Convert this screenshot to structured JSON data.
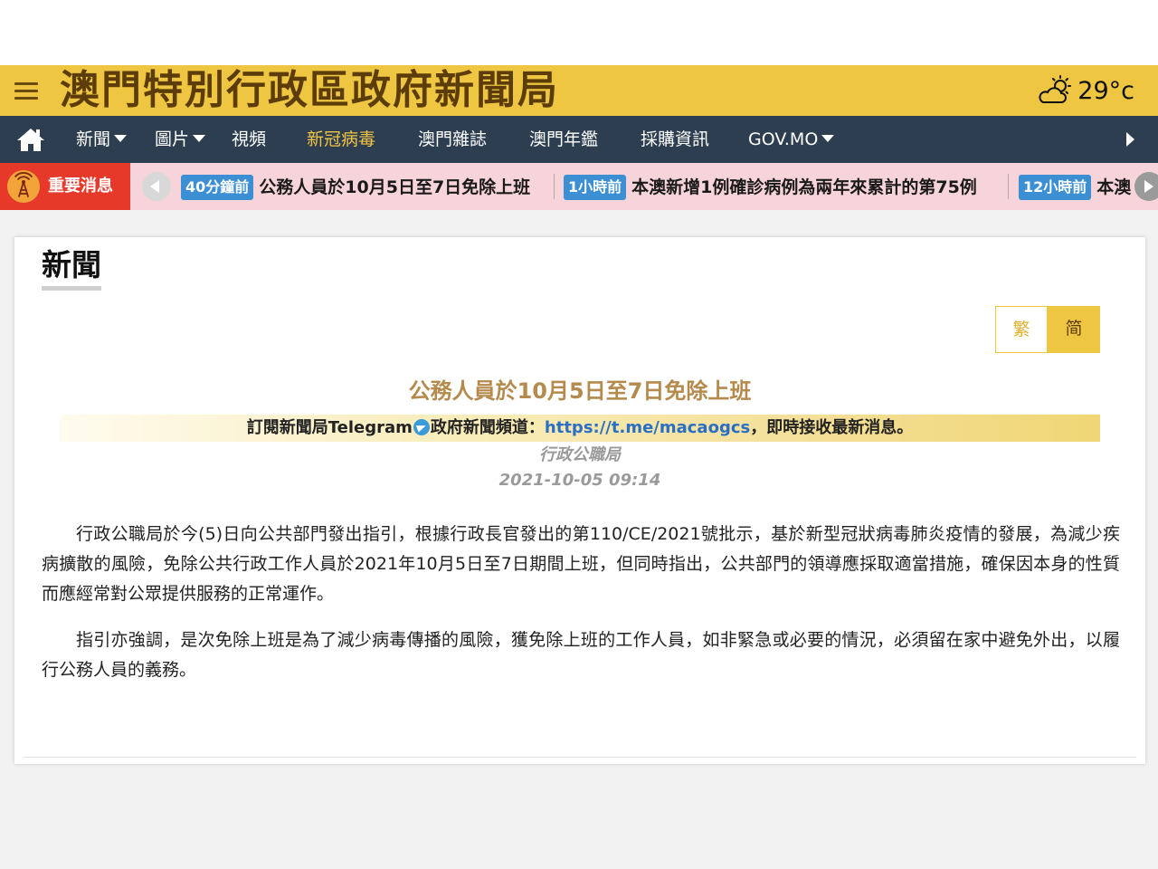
{
  "header": {
    "title": "澳門特別行政區政府新聞局",
    "temperature": "29°c",
    "weather_icon": "partly-cloudy-icon"
  },
  "nav": {
    "items": [
      {
        "label": "新聞"
      },
      {
        "label": "圖片"
      },
      {
        "label": "視頻"
      },
      {
        "label": "新冠病毒"
      },
      {
        "label": "澳門雜誌"
      },
      {
        "label": "澳門年鑑"
      },
      {
        "label": "採購資訊"
      },
      {
        "label": "GOV.MO"
      }
    ],
    "active_color": "#f2c445"
  },
  "ticker": {
    "label": "重要消息",
    "items": [
      {
        "time": "40分鐘前",
        "text": "公務人員於10月5日至7日免除上班"
      },
      {
        "time": "1小時前",
        "text": "本澳新增1例確診病例為兩年來累計的第75例"
      },
      {
        "time": "12小時前",
        "text": "本澳"
      }
    ]
  },
  "article": {
    "section_title": "新聞",
    "lang_traditional": "繁",
    "lang_simplified": "简",
    "title": "公務人員於10月5日至7日免除上班",
    "telegram_prefix": "訂閱新聞局Telegram",
    "telegram_middle": "政府新聞頻道：",
    "telegram_link": "https://t.me/macaogcs",
    "telegram_suffix": "，即時接收最新消息。",
    "source": "行政公職局",
    "date": "2021-10-05 09:14",
    "paragraphs": [
      "行政公職局於今(5)日向公共部門發出指引，根據行政長官發出的第110/CE/2021號批示，基於新型冠狀病毒肺炎疫情的發展，為減少疾病擴散的風險，免除公共行政工作人員於2021年10月5日至7日期間上班，但同時指出，公共部門的領導應採取適當措施，確保因本身的性質而應經常對公眾提供服務的正常運作。",
      "指引亦強調，是次免除上班是為了減少病毒傳播的風險，獲免除上班的工作人員，如非緊急或必要的情況，必須留在家中避免外出，以履行公務人員的義務。"
    ]
  },
  "colors": {
    "header_bg": "#eec641",
    "nav_bg": "#2c3e50",
    "ticker_bg": "#f7d4d9",
    "ticker_label_bg": "#e6392a",
    "time_badge": "#3d8fd4",
    "title_color": "#b58a4d"
  }
}
